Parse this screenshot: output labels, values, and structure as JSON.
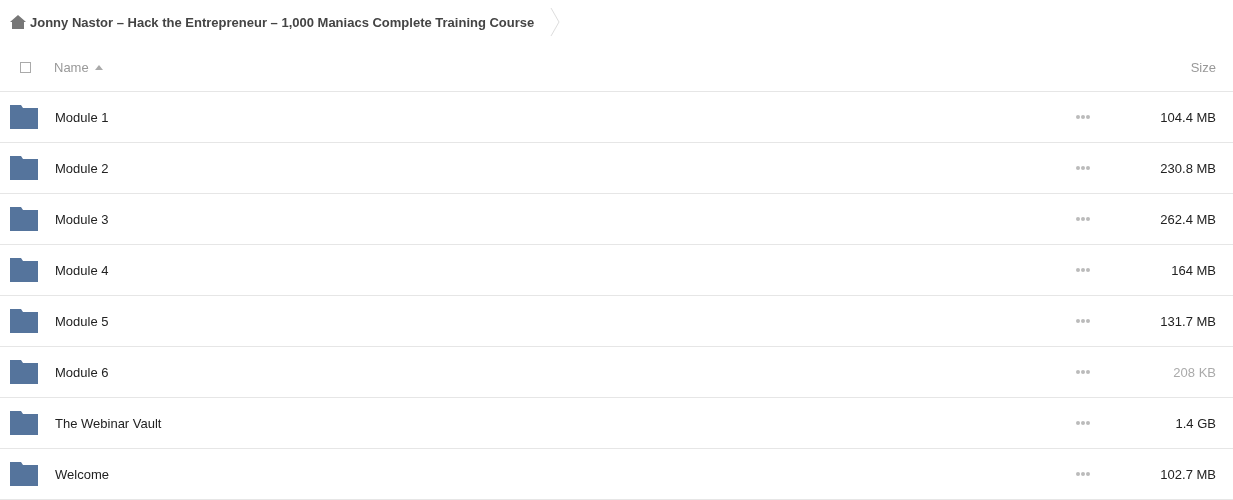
{
  "breadcrumb": {
    "title": "Jonny Nastor – Hack the Entrepreneur – 1,000 Maniacs Complete Training Course"
  },
  "header": {
    "select_all": {
      "checked": false
    },
    "columns": [
      {
        "label": "Name",
        "sorted": true
      },
      {
        "label": "Size",
        "sorted": false
      }
    ]
  },
  "rows": [
    {
      "name": "Module 1",
      "size": "104.4 MB",
      "size_dimmed": false
    },
    {
      "name": "Module 2",
      "size": "230.8 MB",
      "size_dimmed": false
    },
    {
      "name": "Module 3",
      "size": "262.4 MB",
      "size_dimmed": false
    },
    {
      "name": "Module 4",
      "size": "164 MB",
      "size_dimmed": false
    },
    {
      "name": "Module 5",
      "size": "131.7 MB",
      "size_dimmed": false
    },
    {
      "name": "Module 6",
      "size": "208 KB",
      "size_dimmed": true
    },
    {
      "name": "The Webinar Vault",
      "size": "1.4 GB",
      "size_dimmed": false
    },
    {
      "name": "Welcome",
      "size": "102.7 MB",
      "size_dimmed": false
    }
  ]
}
